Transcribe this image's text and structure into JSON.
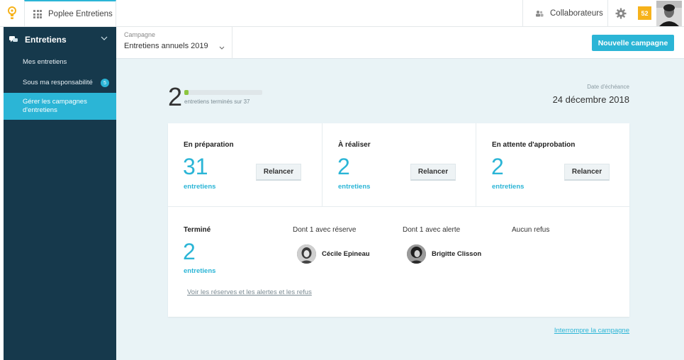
{
  "topbar": {
    "app_name": "Poplee Entretiens",
    "collaborators_label": "Collaborateurs",
    "notification_count": "52"
  },
  "sidebar": {
    "section_label": "Entretiens",
    "items": [
      {
        "label": "Mes entretiens"
      },
      {
        "label": "Sous ma responsabilité",
        "count": "5"
      },
      {
        "label": "Gérer les campagnes d'entretiens",
        "active": true
      }
    ]
  },
  "campaign": {
    "label": "Campagne",
    "value": "Entretiens annuels 2019",
    "new_button": "Nouvelle campagne"
  },
  "summary": {
    "completed": "2",
    "completed_label": "entretiens terminés sur 37",
    "progress": 0.054,
    "due_label": "Date d'échéance",
    "due_date": "24 décembre 2018"
  },
  "stats": [
    {
      "title": "En préparation",
      "value": "31",
      "sub": "entretiens",
      "action": "Relancer"
    },
    {
      "title": "À réaliser",
      "value": "2",
      "sub": "entretiens",
      "action": "Relancer"
    },
    {
      "title": "En attente d'approbation",
      "value": "2",
      "sub": "entretiens",
      "action": "Relancer"
    }
  ],
  "done": {
    "title": "Terminé",
    "value": "2",
    "sub": "entretiens",
    "reserve_label": "Dont 1 avec réserve",
    "reserve_person": "Cécile Epineau",
    "alert_label": "Dont 1 avec alerte",
    "alert_person": "Brigitte Clisson",
    "refusal_label": "Aucun refus",
    "details_link": "Voir les réserves et les alertes et les refus"
  },
  "footer": {
    "stop_link": "Interrompre la campagne"
  },
  "colors": {
    "accent": "#2bb5d6",
    "sidebar": "#16394c",
    "progress": "#8cc63f",
    "badge": "#f6b21b"
  }
}
